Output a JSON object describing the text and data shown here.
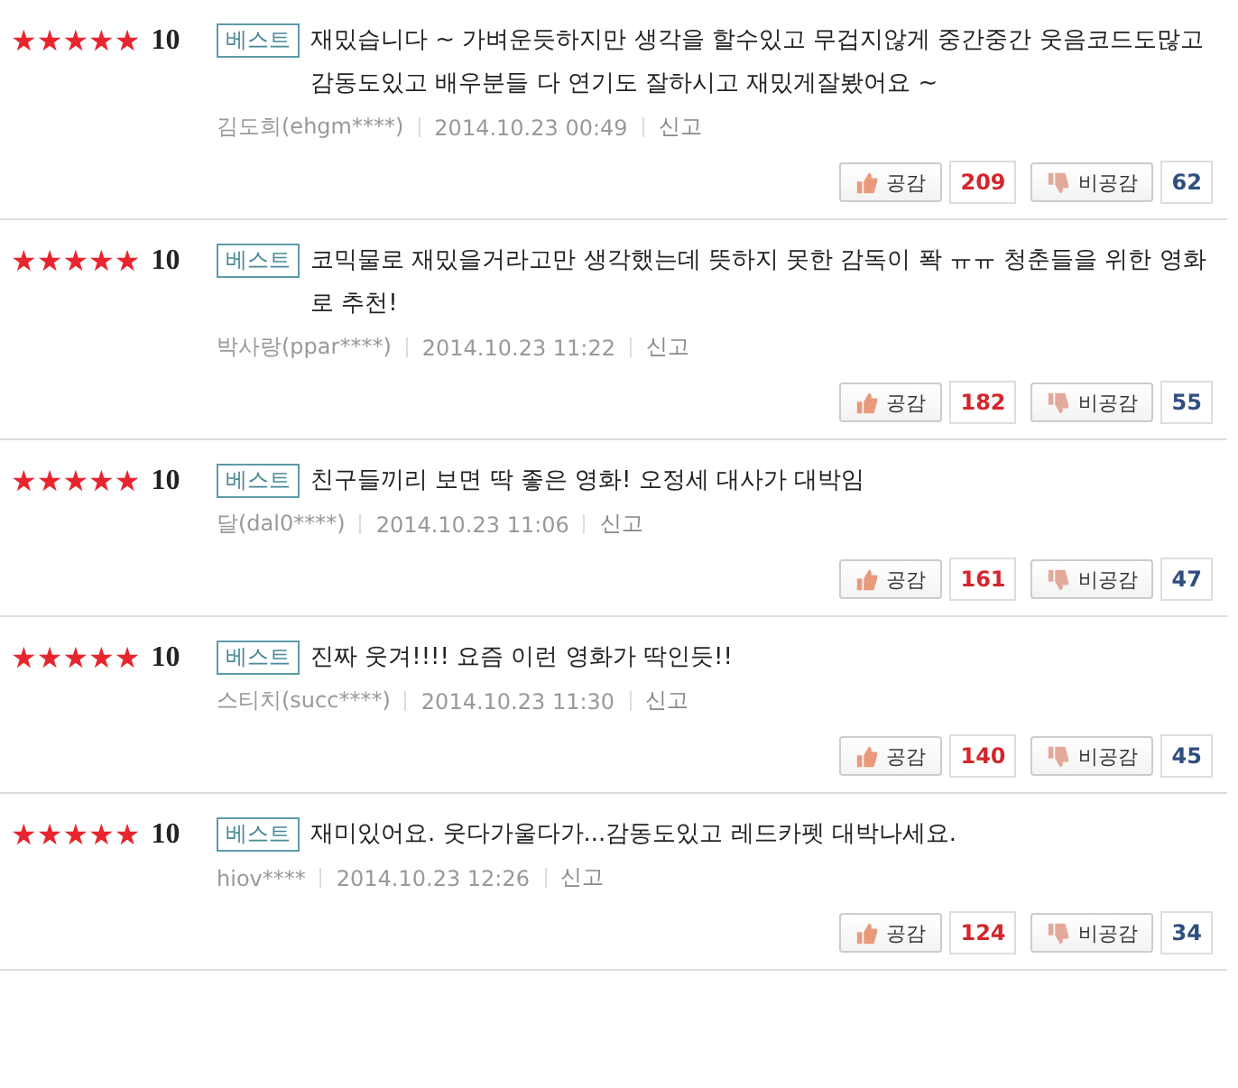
{
  "reviews": [
    {
      "stars": 5,
      "score": "10",
      "badge": "베스트",
      "text": "재밌습니다 ~ 가벼운듯하지만 생각을 할수있고 무겁지않게 중간중간 웃음코드도많고 감동도있고 배우분들 다 연기도 잘하시고 재밌게잘봤어요 ~",
      "author": "김도희(ehgm****)",
      "date": "2014.10.23 00:49",
      "report": "신고",
      "like_label": "공감",
      "likes": "209",
      "dislike_label": "비공감",
      "dislikes": "62"
    },
    {
      "stars": 5,
      "score": "10",
      "badge": "베스트",
      "text": "코믹물로 재밌을거라고만 생각했는데 뜻하지 못한 감독이 퐉 ㅠㅠ 청춘들을 위한 영화로 추천!",
      "author": "박사랑(ppar****)",
      "date": "2014.10.23 11:22",
      "report": "신고",
      "like_label": "공감",
      "likes": "182",
      "dislike_label": "비공감",
      "dislikes": "55"
    },
    {
      "stars": 5,
      "score": "10",
      "badge": "베스트",
      "text": "친구들끼리 보면 딱 좋은 영화! 오정세 대사가 대박임",
      "author": "달(dal0****)",
      "date": "2014.10.23 11:06",
      "report": "신고",
      "like_label": "공감",
      "likes": "161",
      "dislike_label": "비공감",
      "dislikes": "47"
    },
    {
      "stars": 5,
      "score": "10",
      "badge": "베스트",
      "text": "진짜 웃겨!!!! 요즘 이런 영화가 딱인듯!!",
      "author": "스티치(succ****)",
      "date": "2014.10.23 11:30",
      "report": "신고",
      "like_label": "공감",
      "likes": "140",
      "dislike_label": "비공감",
      "dislikes": "45"
    },
    {
      "stars": 5,
      "score": "10",
      "badge": "베스트",
      "text": "재미있어요. 웃다가울다가...감동도있고 레드카펫 대박나세요.",
      "author": "hiov****",
      "date": "2014.10.23 12:26",
      "report": "신고",
      "like_label": "공감",
      "likes": "124",
      "dislike_label": "비공감",
      "dislikes": "34"
    }
  ]
}
